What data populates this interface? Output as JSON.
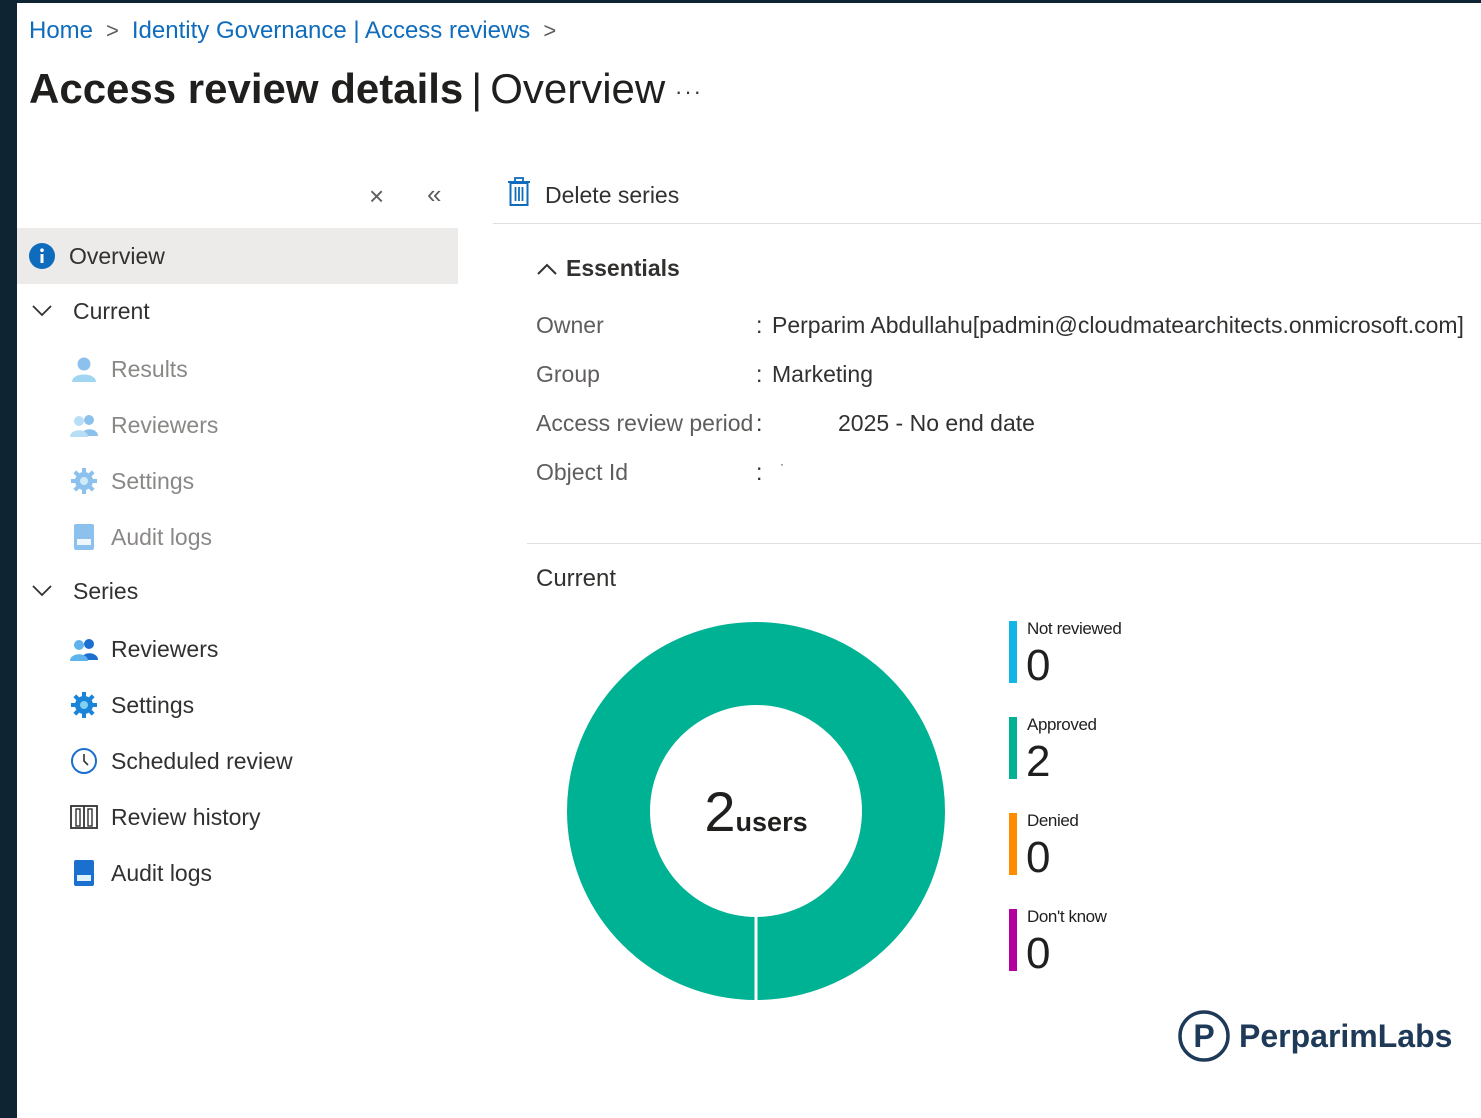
{
  "breadcrumb": {
    "home": "Home",
    "sep": ">",
    "governance": "Identity Governance | Access reviews"
  },
  "title": {
    "main": "Access review details",
    "sep": "|",
    "sub": "Overview",
    "more": "···"
  },
  "nav": {
    "close_glyph": "×",
    "collapse_glyph": "«",
    "overview": "Overview",
    "current": {
      "label": "Current",
      "items": [
        "Results",
        "Reviewers",
        "Settings",
        "Audit logs"
      ]
    },
    "series": {
      "label": "Series",
      "items": [
        "Reviewers",
        "Settings",
        "Scheduled review",
        "Review history",
        "Audit logs"
      ]
    }
  },
  "toolbar": {
    "delete_series": "Delete series"
  },
  "essentials": {
    "heading": "Essentials",
    "colon": ":",
    "owner": {
      "key": "Owner",
      "value": "Perparim Abdullahu[padmin@cloudmatearchitects.onmicrosoft.com]"
    },
    "group": {
      "key": "Group",
      "value": "Marketing"
    },
    "period": {
      "key": "Access review period",
      "value": "2025 - No end date"
    },
    "object_id": {
      "key": "Object Id",
      "value": "·"
    }
  },
  "current_section": {
    "title": "Current",
    "total": "2",
    "unit": "users"
  },
  "chart_data": {
    "type": "pie",
    "categories": [
      "Not reviewed",
      "Approved",
      "Denied",
      "Don't know"
    ],
    "values": [
      0,
      2,
      0,
      0
    ],
    "colors": [
      "#13b4e8",
      "#00b294",
      "#ff8c00",
      "#b4009e"
    ],
    "center_value": "2",
    "center_label": "users"
  },
  "legend": [
    {
      "label": "Not reviewed",
      "value": "0"
    },
    {
      "label": "Approved",
      "value": "2"
    },
    {
      "label": "Denied",
      "value": "0"
    },
    {
      "label": "Don't know",
      "value": "0"
    }
  ],
  "brand": {
    "name": "PerparimLabs",
    "letter": "P"
  }
}
